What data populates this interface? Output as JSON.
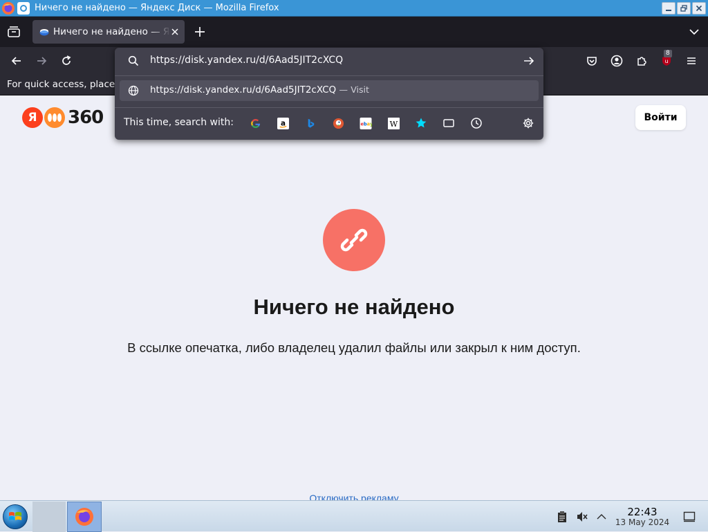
{
  "window": {
    "title": "Ничего не найдено — Яндекс Диск — Mozilla Firefox"
  },
  "tabs": [
    {
      "label": "Ничего не найдено — Я",
      "active": true
    }
  ],
  "toolbar": {
    "extension_badge": "8"
  },
  "bookmarks_bar": {
    "hint": "For quick access, place"
  },
  "urlbar": {
    "value": "https://disk.yandex.ru/d/6Aad5JIT2cXCQ",
    "result": {
      "url": "https://disk.yandex.ru/d/6Aad5JIT2cXCQ",
      "separator": "—",
      "action": "Visit"
    },
    "search_with_label": "This time, search with:",
    "engines": [
      "google-icon",
      "amazon-icon",
      "bing-icon",
      "duckduckgo-icon",
      "ebay-icon",
      "wikipedia-icon",
      "bookmarks-icon",
      "tabs-icon",
      "history-icon"
    ]
  },
  "page": {
    "logo_letter": "Я",
    "logo_number": "360",
    "login_label": "Войти",
    "error_title": "Ничего не найдено",
    "error_subtitle": "В ссылке опечатка, либо владелец удалил файлы или закрыл к ним доступ.",
    "disable_ads_link": "Отключить рекламу"
  },
  "taskbar": {
    "time": "22:43",
    "date": "13 May 2024"
  },
  "colors": {
    "titlebar": "#3a95d6",
    "tabstrip": "#1c1b22",
    "navbar": "#2b2a33",
    "page_bg": "#eeeff7",
    "error_circle": "#f77166",
    "yandex_red": "#fc3f1d",
    "link": "#2a6bc4"
  }
}
